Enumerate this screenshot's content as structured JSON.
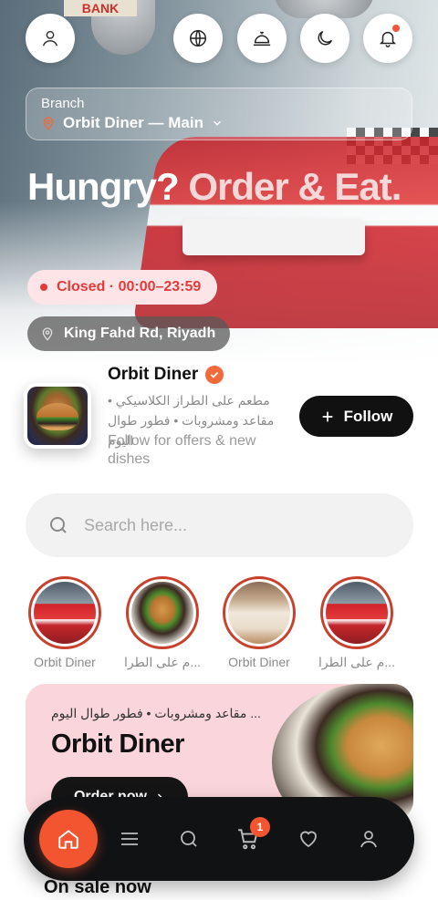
{
  "hero": {
    "sign_text": "BANK",
    "branch_label": "Branch",
    "branch_name": "Orbit Diner — Main",
    "title_part1": "Hungry?",
    "title_part2": " Order & Eat.",
    "status": "Closed · 00:00–23:59",
    "location": "King Fahd Rd, Riyadh",
    "icons": [
      "user-icon",
      "globe-icon",
      "service-bell-icon",
      "moon-icon",
      "bell-icon"
    ]
  },
  "profile": {
    "name": "Orbit Diner",
    "description_ar": "مطعم على الطراز الكلاسيكي • مقاعد ومشروبات • فطور طوال اليوم",
    "subtext": "Follow for offers & new dishes",
    "follow_label": "Follow"
  },
  "search": {
    "placeholder": "Search here..."
  },
  "stories": [
    {
      "label": "Orbit Diner",
      "thumb": "diner"
    },
    {
      "label": "...م على الطرا",
      "thumb": "burger"
    },
    {
      "label": "Orbit Diner",
      "thumb": "shake"
    },
    {
      "label": "...م على الطرا",
      "thumb": "diner"
    }
  ],
  "promo": {
    "description_ar": "... مقاعد ومشروبات • فطور طوال اليوم",
    "title": "Orbit Diner",
    "button_label": "Order now"
  },
  "section": {
    "on_sale": "On sale now"
  },
  "nav": {
    "items": [
      "home-icon",
      "menu-icon",
      "search-icon",
      "cart-icon",
      "heart-icon",
      "profile-icon"
    ],
    "cart_count": "1"
  },
  "colors": {
    "accent": "#f2552f",
    "closed_text": "#e23b3b",
    "closed_bg": "#fde4e6",
    "promo_bg": "#fad5dc",
    "nav_bg": "#111214"
  }
}
